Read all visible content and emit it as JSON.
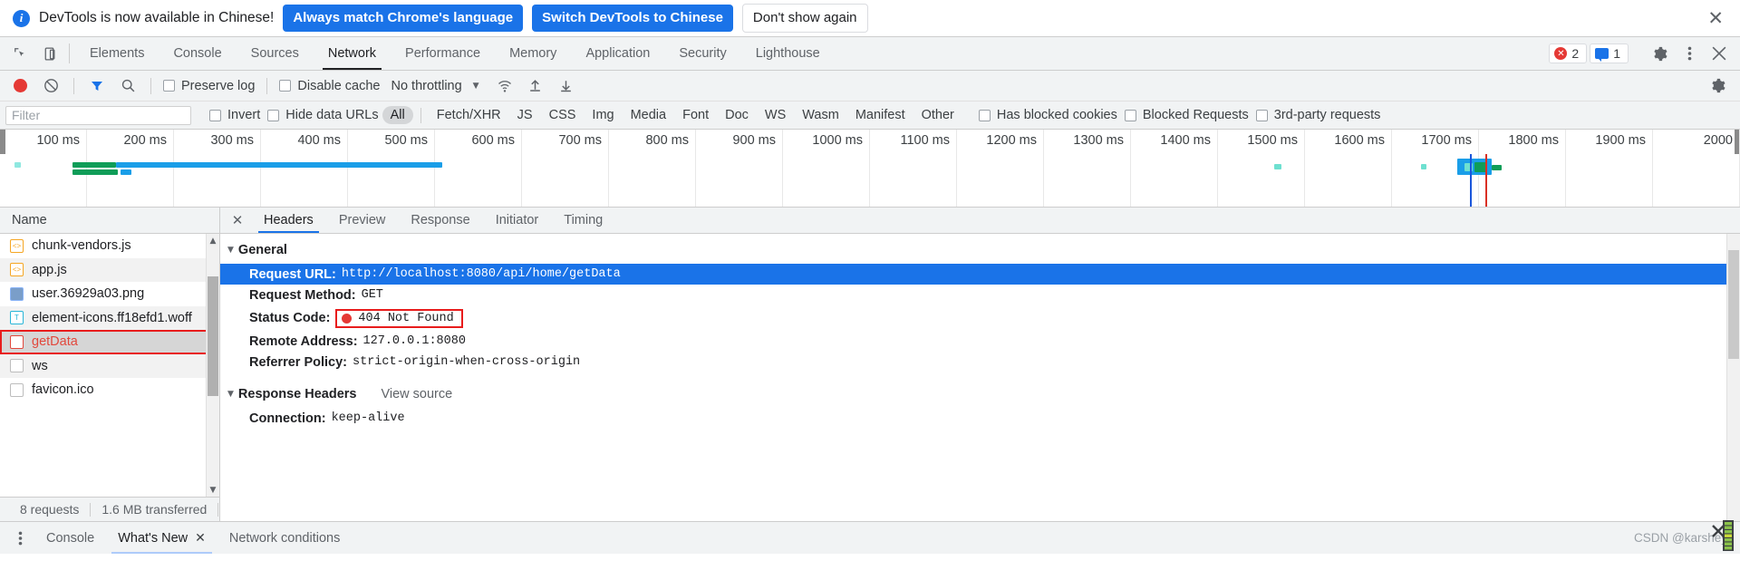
{
  "notification": {
    "icon": "info-icon",
    "message": "DevTools is now available in Chinese!",
    "primary_button": "Always match Chrome's language",
    "secondary_button": "Switch DevTools to Chinese",
    "dismiss_button": "Don't show again",
    "close_icon": "close-icon",
    "accent_color": "#1a73e8"
  },
  "tabbar": {
    "inspect_icon": "inspect-element-icon",
    "device_icon": "device-toolbar-icon",
    "tabs": [
      {
        "label": "Elements",
        "active": false
      },
      {
        "label": "Console",
        "active": false
      },
      {
        "label": "Sources",
        "active": false
      },
      {
        "label": "Network",
        "active": true
      },
      {
        "label": "Performance",
        "active": false
      },
      {
        "label": "Memory",
        "active": false
      },
      {
        "label": "Application",
        "active": false
      },
      {
        "label": "Security",
        "active": false
      },
      {
        "label": "Lighthouse",
        "active": false
      }
    ],
    "error_count": "2",
    "message_count": "1",
    "settings_icon": "gear-icon",
    "more_icon": "kebab-menu-icon",
    "close_icon": "close-icon",
    "error_color": "#e53935",
    "message_color": "#1a73e8"
  },
  "network_toolbar": {
    "record_icon": "record-button",
    "clear_icon": "clear-icon",
    "filter_icon": "filter-funnel-icon",
    "search_icon": "search-icon",
    "preserve_log": "Preserve log",
    "disable_cache": "Disable cache",
    "throttling": "No throttling",
    "throttle_caret": "chevron-down-icon",
    "wifi_icon": "network-conditions-icon",
    "import_icon": "import-har-icon",
    "export_icon": "export-har-icon",
    "settings_icon": "gear-icon",
    "record_color": "#e53935",
    "filter_color": "#1a73e8"
  },
  "filterbar": {
    "placeholder": "Filter",
    "value": "",
    "invert": "Invert",
    "hide_data_urls": "Hide data URLs",
    "types": [
      {
        "label": "All",
        "selected": true
      },
      {
        "label": "Fetch/XHR",
        "selected": false
      },
      {
        "label": "JS",
        "selected": false
      },
      {
        "label": "CSS",
        "selected": false
      },
      {
        "label": "Img",
        "selected": false
      },
      {
        "label": "Media",
        "selected": false
      },
      {
        "label": "Font",
        "selected": false
      },
      {
        "label": "Doc",
        "selected": false
      },
      {
        "label": "WS",
        "selected": false
      },
      {
        "label": "Wasm",
        "selected": false
      },
      {
        "label": "Manifest",
        "selected": false
      },
      {
        "label": "Other",
        "selected": false
      }
    ],
    "has_blocked_cookies": "Has blocked cookies",
    "blocked_requests": "Blocked Requests",
    "third_party": "3rd-party requests"
  },
  "overview": {
    "ticks": [
      "100 ms",
      "200 ms",
      "300 ms",
      "400 ms",
      "500 ms",
      "600 ms",
      "700 ms",
      "800 ms",
      "900 ms",
      "1000 ms",
      "1100 ms",
      "1200 ms",
      "1300 ms",
      "1400 ms",
      "1500 ms",
      "1600 ms",
      "1700 ms",
      "1800 ms",
      "1900 ms",
      "2000"
    ],
    "dom_content_loaded_color": "#1a56db",
    "load_event_color": "#d93025",
    "bar_color": "#1a9ee8",
    "receiving_color": "#0f9d58"
  },
  "requests": {
    "column_header": "Name",
    "items": [
      {
        "name": "chunk-vendors.js",
        "type": "js",
        "icon": "javascript-file-icon",
        "selected": false,
        "highlighted": false
      },
      {
        "name": "app.js",
        "type": "js",
        "icon": "javascript-file-icon",
        "selected": false,
        "highlighted": false
      },
      {
        "name": "user.36929a03.png",
        "type": "img",
        "icon": "image-file-icon",
        "selected": false,
        "highlighted": false
      },
      {
        "name": "element-icons.ff18efd1.woff",
        "type": "font",
        "icon": "font-file-icon",
        "selected": false,
        "highlighted": false
      },
      {
        "name": "getData",
        "type": "doc-red",
        "icon": "generic-file-icon",
        "selected": true,
        "highlighted": true
      },
      {
        "name": "ws",
        "type": "doc",
        "icon": "generic-file-icon",
        "selected": false,
        "highlighted": false
      },
      {
        "name": "favicon.ico",
        "type": "doc",
        "icon": "generic-file-icon",
        "selected": false,
        "highlighted": false
      }
    ],
    "scroll_up_icon": "chevron-up-icon",
    "scroll_down_icon": "chevron-down-icon",
    "highlight_color": "#e81c1c"
  },
  "statusbar": {
    "requests": "8 requests",
    "transferred": "1.6 MB transferred"
  },
  "details": {
    "close_icon": "close-icon",
    "tabs": [
      {
        "label": "Headers",
        "active": true
      },
      {
        "label": "Preview",
        "active": false
      },
      {
        "label": "Response",
        "active": false
      },
      {
        "label": "Initiator",
        "active": false
      },
      {
        "label": "Timing",
        "active": false
      }
    ],
    "general": {
      "title": "General",
      "rows": [
        {
          "key": "Request URL:",
          "value": "http://localhost:8080/api/home/getData",
          "selected": true,
          "status": false
        },
        {
          "key": "Request Method:",
          "value": "GET",
          "selected": false,
          "status": false
        },
        {
          "key": "Status Code:",
          "value": "404 Not Found",
          "selected": false,
          "status": true
        },
        {
          "key": "Remote Address:",
          "value": "127.0.0.1:8080",
          "selected": false,
          "status": false
        },
        {
          "key": "Referrer Policy:",
          "value": "strict-origin-when-cross-origin",
          "selected": false,
          "status": false
        }
      ]
    },
    "response_headers": {
      "title": "Response Headers",
      "view_source": "View source",
      "rows": [
        {
          "key": "Connection:",
          "value": "keep-alive"
        }
      ]
    },
    "selected_row_color": "#1a73e8",
    "status_highlight_color": "#e81c1c"
  },
  "drawer": {
    "more_icon": "kebab-menu-icon",
    "tabs": [
      {
        "label": "Console",
        "active": false,
        "closable": false
      },
      {
        "label": "What's New",
        "active": true,
        "closable": true
      },
      {
        "label": "Network conditions",
        "active": false,
        "closable": false
      }
    ],
    "close_icon": "close-icon"
  },
  "watermark": {
    "text": "CSDN @karshey"
  }
}
